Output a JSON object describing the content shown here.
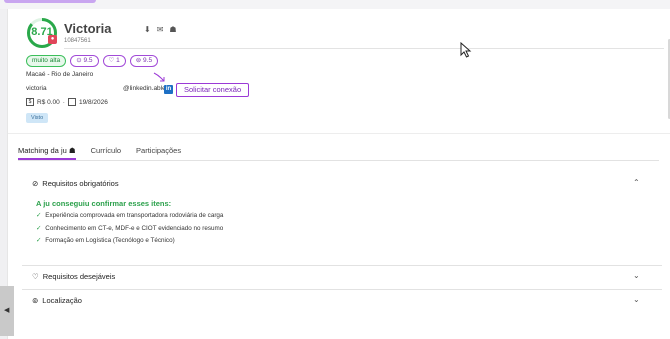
{
  "candidate": {
    "score": "8.71",
    "name": "Victoria",
    "id": "10847561",
    "location": "Macaé - Rio de Janeiro",
    "username": "victoria",
    "linkedin_handle": "@linkedin.abler",
    "salary": "R$ 0.00",
    "date": "19/8/2026",
    "status": "Visto"
  },
  "badges": [
    {
      "label": "muito alta"
    },
    {
      "label": "9.5"
    },
    {
      "label": "1"
    },
    {
      "label": "9.5"
    }
  ],
  "buttons": {
    "connect": "Solicitar conexão"
  },
  "tabs": [
    {
      "label": "Matching da ju"
    },
    {
      "label": "Currículo"
    },
    {
      "label": "Participações"
    }
  ],
  "sections": {
    "mandatory": "Requisitos obrigatórios",
    "confirmed_title": "A ju conseguiu confirmar esses itens:",
    "requirements": [
      "Experiência comprovada em transportadora rodoviária de carga",
      "Conhecimento em CT-e, MDF-e e CIOT evidenciado no resumo",
      "Formação em Logística (Tecnólogo e Técnico)"
    ],
    "desirable": "Requisitos desejáveis",
    "location": "Localização"
  },
  "colors": {
    "accent": "#9b3ad6",
    "score_green": "#2aa84a",
    "linkedin": "#1d6fc4"
  }
}
